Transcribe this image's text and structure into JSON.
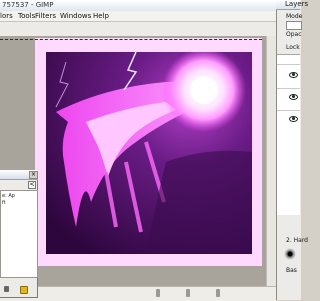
{
  "window": {
    "title": "757537 - GIMP"
  },
  "menu": {
    "items": [
      "lors",
      "Tools",
      "Filters",
      "Windows",
      "Help"
    ]
  },
  "layers_dock": {
    "title": "Layers",
    "mode_label": "Mode",
    "opacity_label": "Opac",
    "lock_label": "Lock",
    "mode_value": "",
    "brush_label": "Bas",
    "hardness_label": "2. Hard"
  },
  "dialog": {
    "close_label": "×",
    "chevron": "<",
    "lines": [
      "e: Ap",
      "ft"
    ]
  },
  "colors": {
    "canvas_border": "#ffd9ff",
    "accent_magenta": "#ff4cff",
    "art_dark": "#4a0a60"
  }
}
